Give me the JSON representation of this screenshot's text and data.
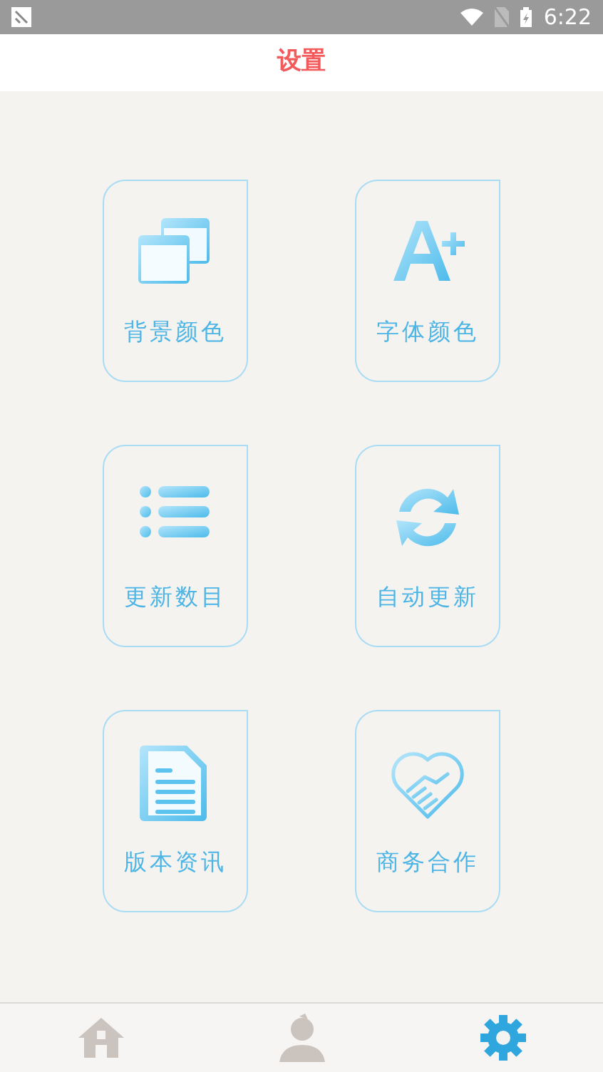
{
  "status_bar": {
    "time": "6:22"
  },
  "header": {
    "title": "设置"
  },
  "tiles": [
    {
      "label": "背景颜色",
      "kind": "windows"
    },
    {
      "label": "字体颜色",
      "kind": "font"
    },
    {
      "label": "更新数目",
      "kind": "list"
    },
    {
      "label": "自动更新",
      "kind": "refresh"
    },
    {
      "label": "版本资讯",
      "kind": "document"
    },
    {
      "label": "商务合作",
      "kind": "handshake"
    }
  ],
  "bottom_nav": [
    {
      "kind": "home",
      "selected": false
    },
    {
      "kind": "profile",
      "selected": false
    },
    {
      "kind": "settings",
      "selected": true
    }
  ]
}
